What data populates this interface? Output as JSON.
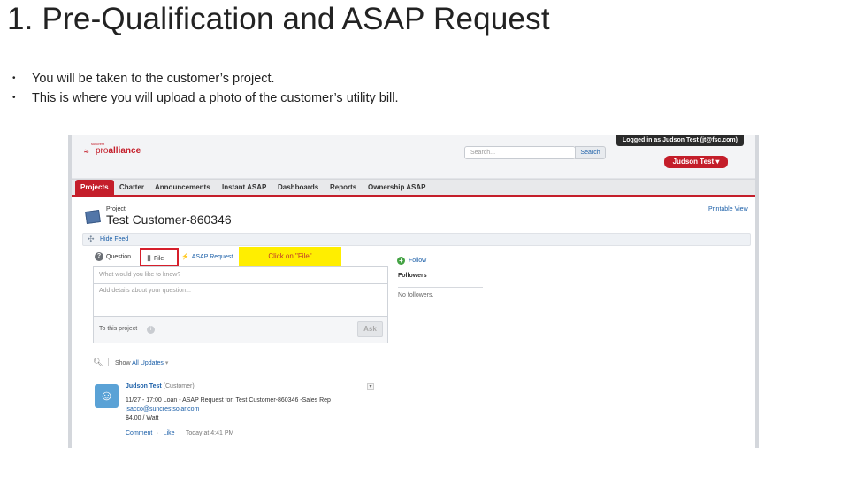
{
  "slide": {
    "title": "1. Pre-Qualification and ASAP Request",
    "bullets": [
      "You will be taken to the customer’s project.",
      "This is where you will upload a photo of the customer’s utility bill."
    ],
    "bullet_char": "•"
  },
  "header": {
    "logo_small": "suncrest",
    "logo_text_light": "pro",
    "logo_text_bold": "alliance",
    "search_placeholder": "Search...",
    "search_button": "Search",
    "logged_in": "Logged in as Judson Test (jt@fsc.com)",
    "user_menu": "Judson Test ▾"
  },
  "tabs": [
    {
      "label": "Projects",
      "active": true
    },
    {
      "label": "Chatter",
      "active": false
    },
    {
      "label": "Announcements",
      "active": false
    },
    {
      "label": "Instant ASAP",
      "active": false
    },
    {
      "label": "Dashboards",
      "active": false
    },
    {
      "label": "Reports",
      "active": false
    },
    {
      "label": "Ownership ASAP",
      "active": false
    }
  ],
  "record": {
    "type_label": "Project",
    "name": "Test Customer-860346",
    "printable_view": "Printable View",
    "hide_feed": "Hide Feed"
  },
  "publisher": {
    "tabs": [
      "Question",
      "File",
      "ASAP Request"
    ],
    "callout": "Click on \"File\"",
    "question_placeholder": "What would you like to know?",
    "details_placeholder": "Add details about your question...",
    "to_project": "To this project",
    "ask_button": "Ask"
  },
  "followers": {
    "follow_link": "Follow",
    "heading": "Followers",
    "empty": "No followers."
  },
  "feed_filter": {
    "show_label": "Show",
    "all_updates": "All Updates",
    "caret": "▾"
  },
  "post": {
    "author": "Judson Test",
    "role": "(Customer)",
    "line1": "11/27 - 17:00 Loan - ASAP Request for: Test Customer-860346 -Sales Rep",
    "email": "jsacco@suncrestsolar.com",
    "rate": "$4.00 / Watt",
    "comment": "Comment",
    "like": "Like",
    "timestamp": "Today at 4:41 PM"
  },
  "colors": {
    "brand_red": "#c41e2a",
    "link_blue": "#1b5fa8",
    "callout_yellow": "#ffee00",
    "highlight_border": "#d61f2b"
  }
}
